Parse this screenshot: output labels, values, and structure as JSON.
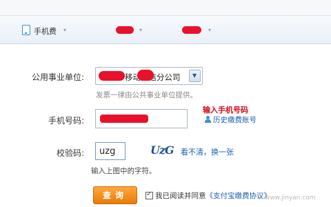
{
  "nav": {
    "phone_label": "手机费",
    "arrow": "▾"
  },
  "form": {
    "company_label": "公用事业单位:",
    "company_value": "移动通信分公司",
    "company_hint": "发票一律由公共事业单位提供。",
    "phone_label": "手机号码:",
    "phone_annotation": "输入手机号码",
    "history_link": "历史缴费账号",
    "captcha_label": "校验码:",
    "captcha_value": "uzg",
    "captcha_image_text": "UzG",
    "refresh_link": "看不清，换一张",
    "captcha_hint": "输入上图中的字符。",
    "submit_label": "查询",
    "agree_text": "我已阅读并同意",
    "agree_link": "《支付宝缴费协议》"
  },
  "watermark": "www.jinyan.com",
  "colors": {
    "redaction": "#e8112b",
    "accent_blue": "#1a5fb4",
    "submit_orange": "#f08a12"
  }
}
